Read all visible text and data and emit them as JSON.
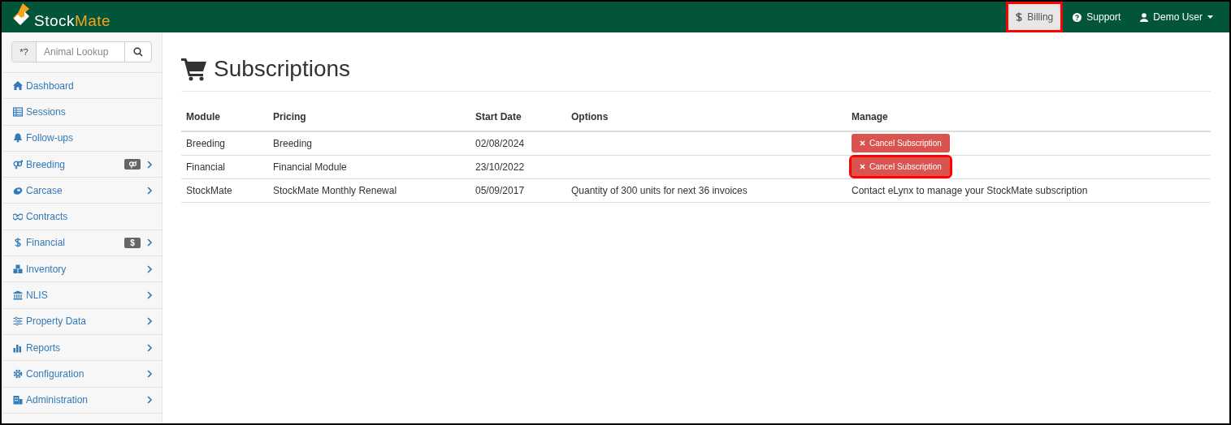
{
  "brand": {
    "part1": "Stock",
    "part2": "Mate"
  },
  "topnav": [
    {
      "label": "Billing",
      "selected": true,
      "highlighted": true
    },
    {
      "label": "Support",
      "selected": false,
      "highlighted": false
    },
    {
      "label": "Demo User",
      "selected": false,
      "highlighted": false
    }
  ],
  "search": {
    "prefix": "*?",
    "placeholder": "Animal Lookup"
  },
  "sidebar": {
    "items": [
      {
        "label": "Dashboard",
        "badge": false,
        "expandable": false
      },
      {
        "label": "Sessions",
        "badge": false,
        "expandable": false
      },
      {
        "label": "Follow-ups",
        "badge": false,
        "expandable": false
      },
      {
        "label": "Breeding",
        "badge": true,
        "expandable": true
      },
      {
        "label": "Carcase",
        "badge": false,
        "expandable": true
      },
      {
        "label": "Contracts",
        "badge": false,
        "expandable": false
      },
      {
        "label": "Financial",
        "badge": true,
        "badge_text": "$",
        "expandable": true
      },
      {
        "label": "Inventory",
        "badge": false,
        "expandable": true
      },
      {
        "label": "NLIS",
        "badge": false,
        "expandable": true
      },
      {
        "label": "Property Data",
        "badge": false,
        "expandable": true
      },
      {
        "label": "Reports",
        "badge": false,
        "expandable": true
      },
      {
        "label": "Configuration",
        "badge": false,
        "expandable": true
      },
      {
        "label": "Administration",
        "badge": false,
        "expandable": true
      }
    ]
  },
  "page": {
    "title": "Subscriptions"
  },
  "table": {
    "columns": [
      "Module",
      "Pricing",
      "Start Date",
      "Options",
      "Manage"
    ],
    "rows": [
      {
        "module": "Breeding",
        "pricing": "Breeding",
        "start_date": "02/08/2024",
        "manage": {
          "kind": "button",
          "label": "Cancel Subscription",
          "highlighted": false
        }
      },
      {
        "module": "Financial",
        "pricing": "Financial Module",
        "start_date": "23/10/2022",
        "manage": {
          "kind": "button",
          "label": "Cancel Subscription",
          "highlighted": true
        }
      },
      {
        "module": "StockMate",
        "pricing": "StockMate Monthly Renewal",
        "start_date": "05/09/2017",
        "options": "Quantity of 300 units for next 36 invoices",
        "manage": {
          "kind": "text",
          "label": "Contact eLynx to manage your StockMate subscription"
        }
      }
    ]
  }
}
